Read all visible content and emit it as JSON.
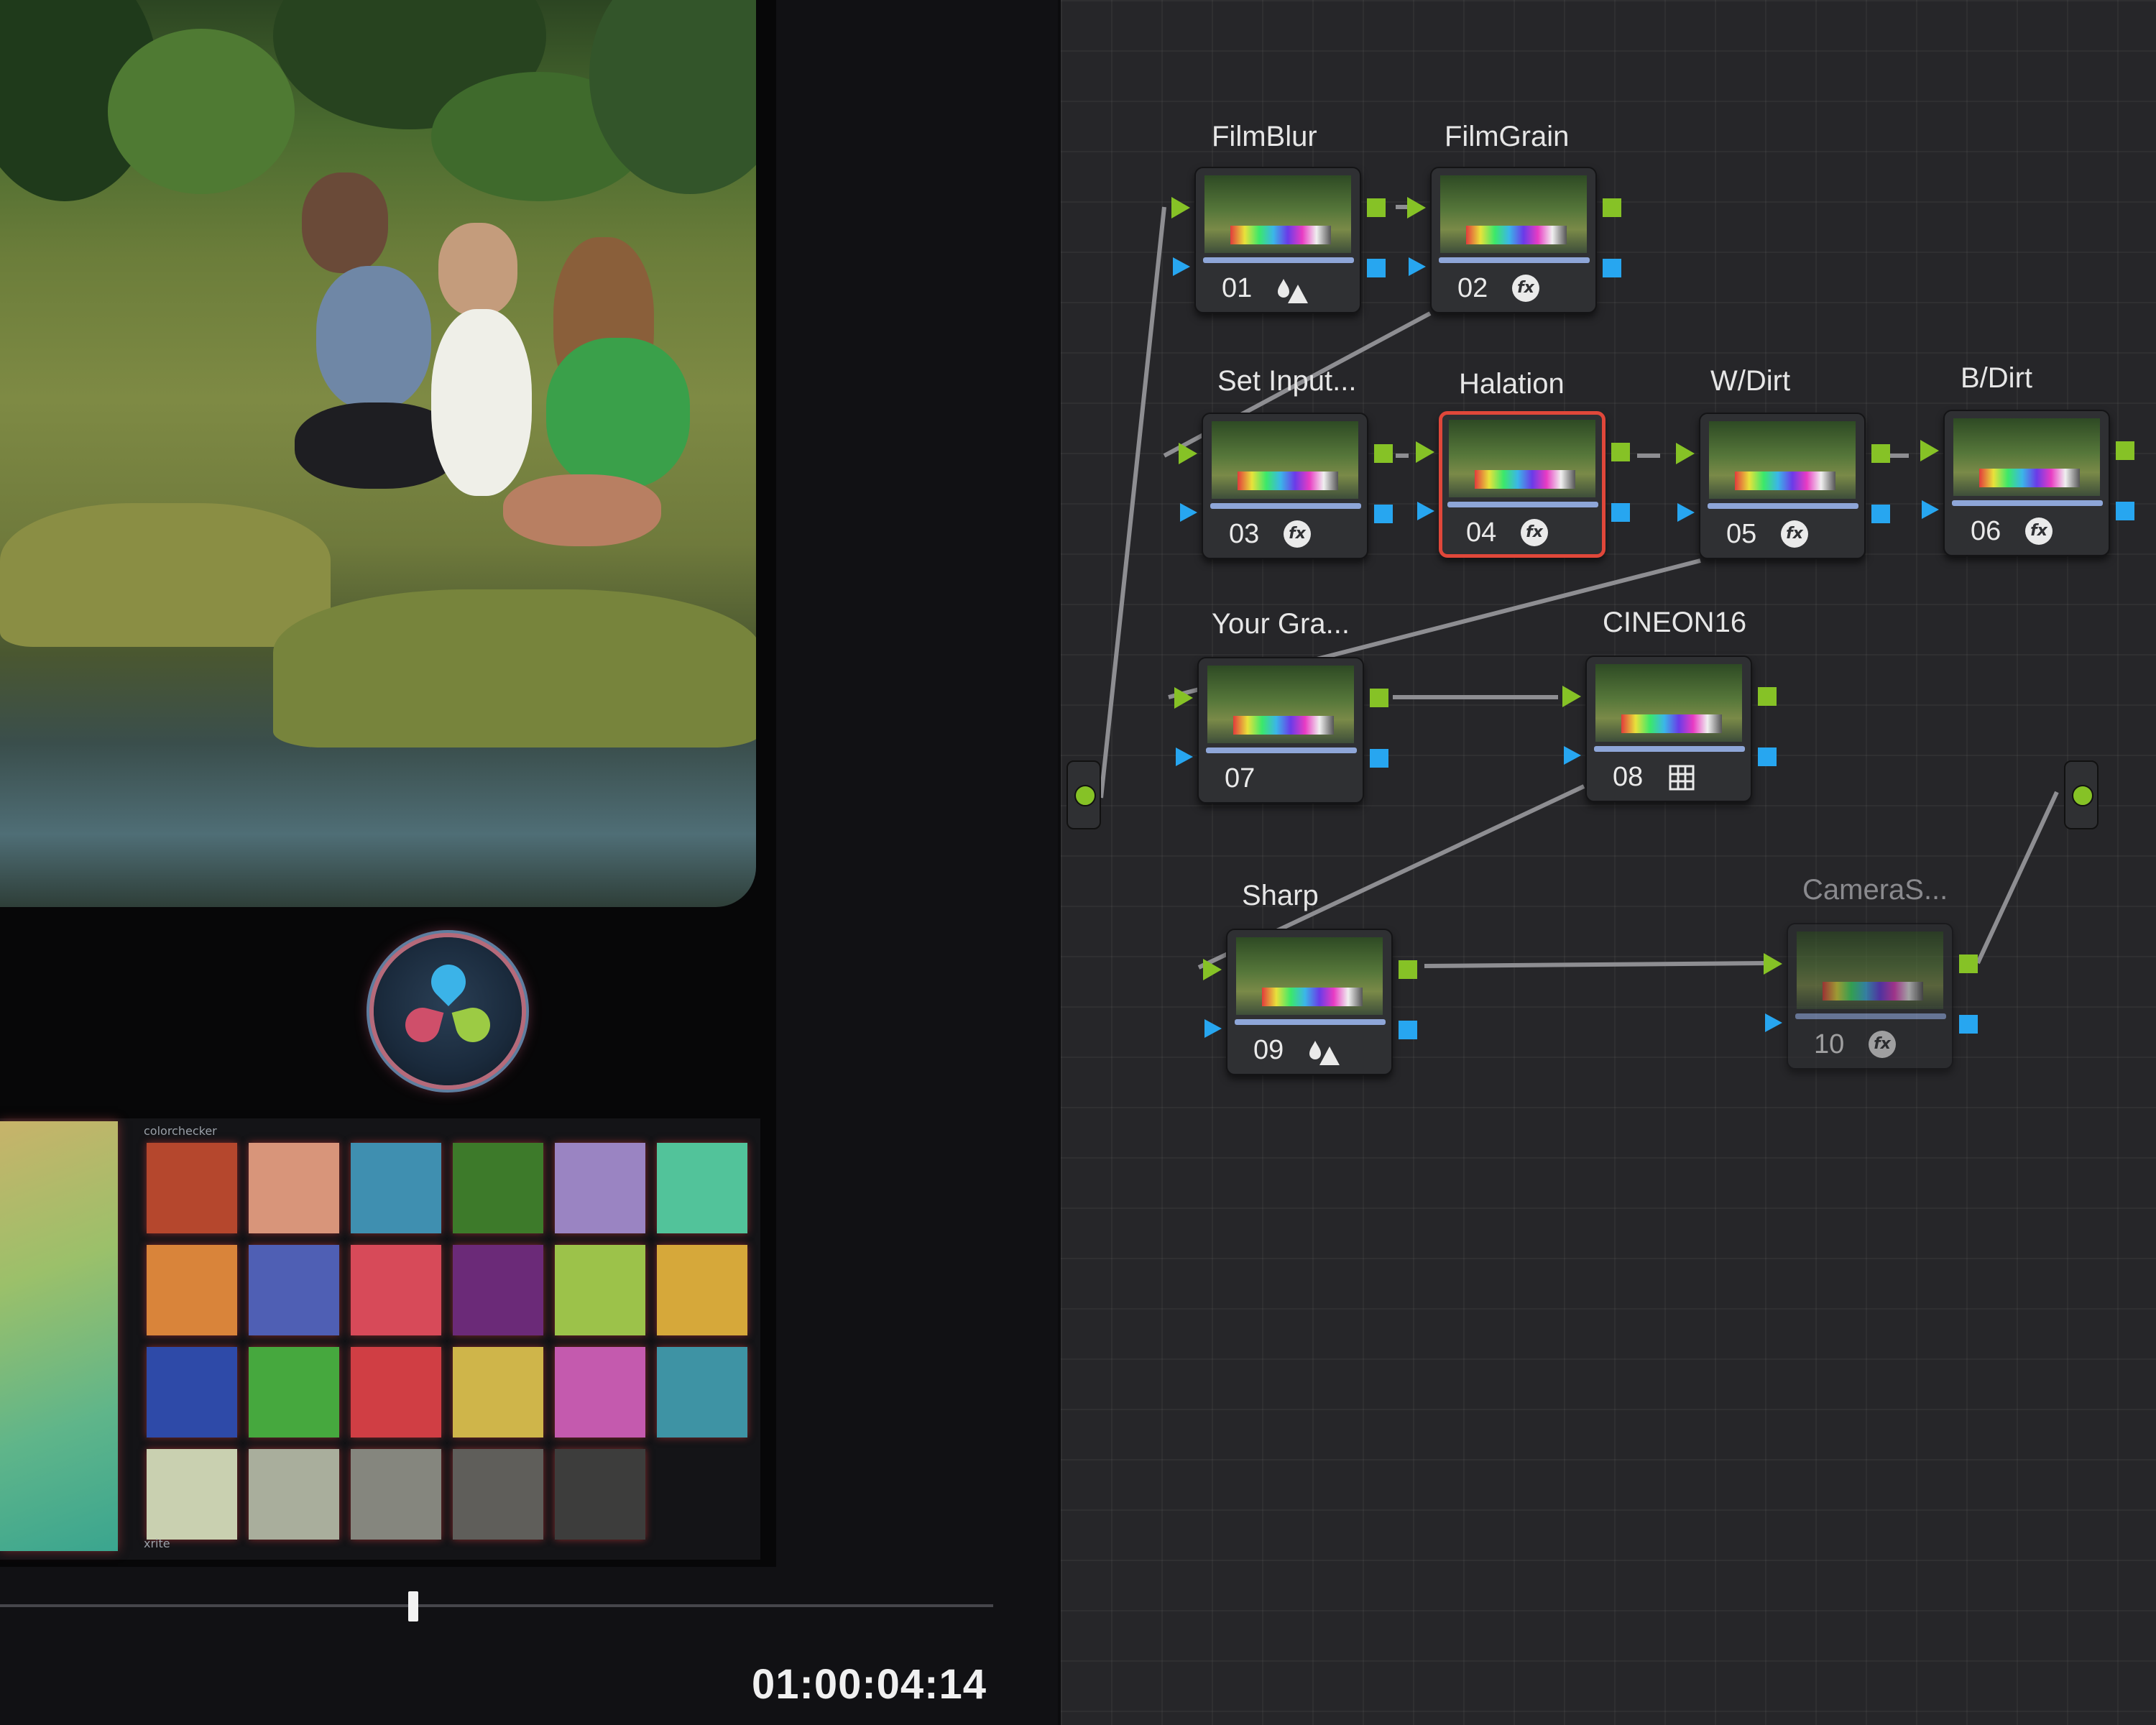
{
  "viewer": {
    "timecode": "01:00:04:14",
    "checker_brand": "colorchecker",
    "checker_maker": "xrite",
    "checker_colors": [
      [
        "#b5472d",
        "#d8957a",
        "#3f8fb0",
        "#3d7a2a",
        "#9a84c2",
        "#52c39a"
      ],
      [
        "#d9843a",
        "#4f5fb4",
        "#d74a59",
        "#6b2a78",
        "#9cc24a",
        "#d6a83a"
      ],
      [
        "#2e4aa8",
        "#46a83e",
        "#d03e44",
        "#cfb54a",
        "#c45aae",
        "#3e93a4"
      ],
      [
        "#c9d0b0",
        "#a9ae9c",
        "#85867e",
        "#5f5e5a",
        "#3d3d3c",
        ""
      ]
    ]
  },
  "node_graph": {
    "nodes": [
      {
        "id": "01",
        "label": "FilmBlur",
        "icon": "drops-triangle-icon"
      },
      {
        "id": "02",
        "label": "FilmGrain",
        "icon": "fx-icon"
      },
      {
        "id": "03",
        "label": "Set Input...",
        "icon": "fx-icon"
      },
      {
        "id": "04",
        "label": "Halation",
        "icon": "fx-icon",
        "selected": true
      },
      {
        "id": "05",
        "label": "W/Dirt",
        "icon": "fx-icon"
      },
      {
        "id": "06",
        "label": "B/Dirt",
        "icon": "fx-icon"
      },
      {
        "id": "07",
        "label": "Your Gra...",
        "icon": ""
      },
      {
        "id": "08",
        "label": "CINEON16",
        "icon": "grid-icon"
      },
      {
        "id": "09",
        "label": "Sharp",
        "icon": "drops-triangle-icon"
      },
      {
        "id": "10",
        "label": "CameraS...",
        "icon": "fx-icon",
        "disabled": true
      }
    ],
    "colors": {
      "rgb_pin": "#86c226",
      "alpha_pin": "#27a6f0",
      "selected_border": "#e0473a",
      "link": "#8e8e92"
    }
  }
}
